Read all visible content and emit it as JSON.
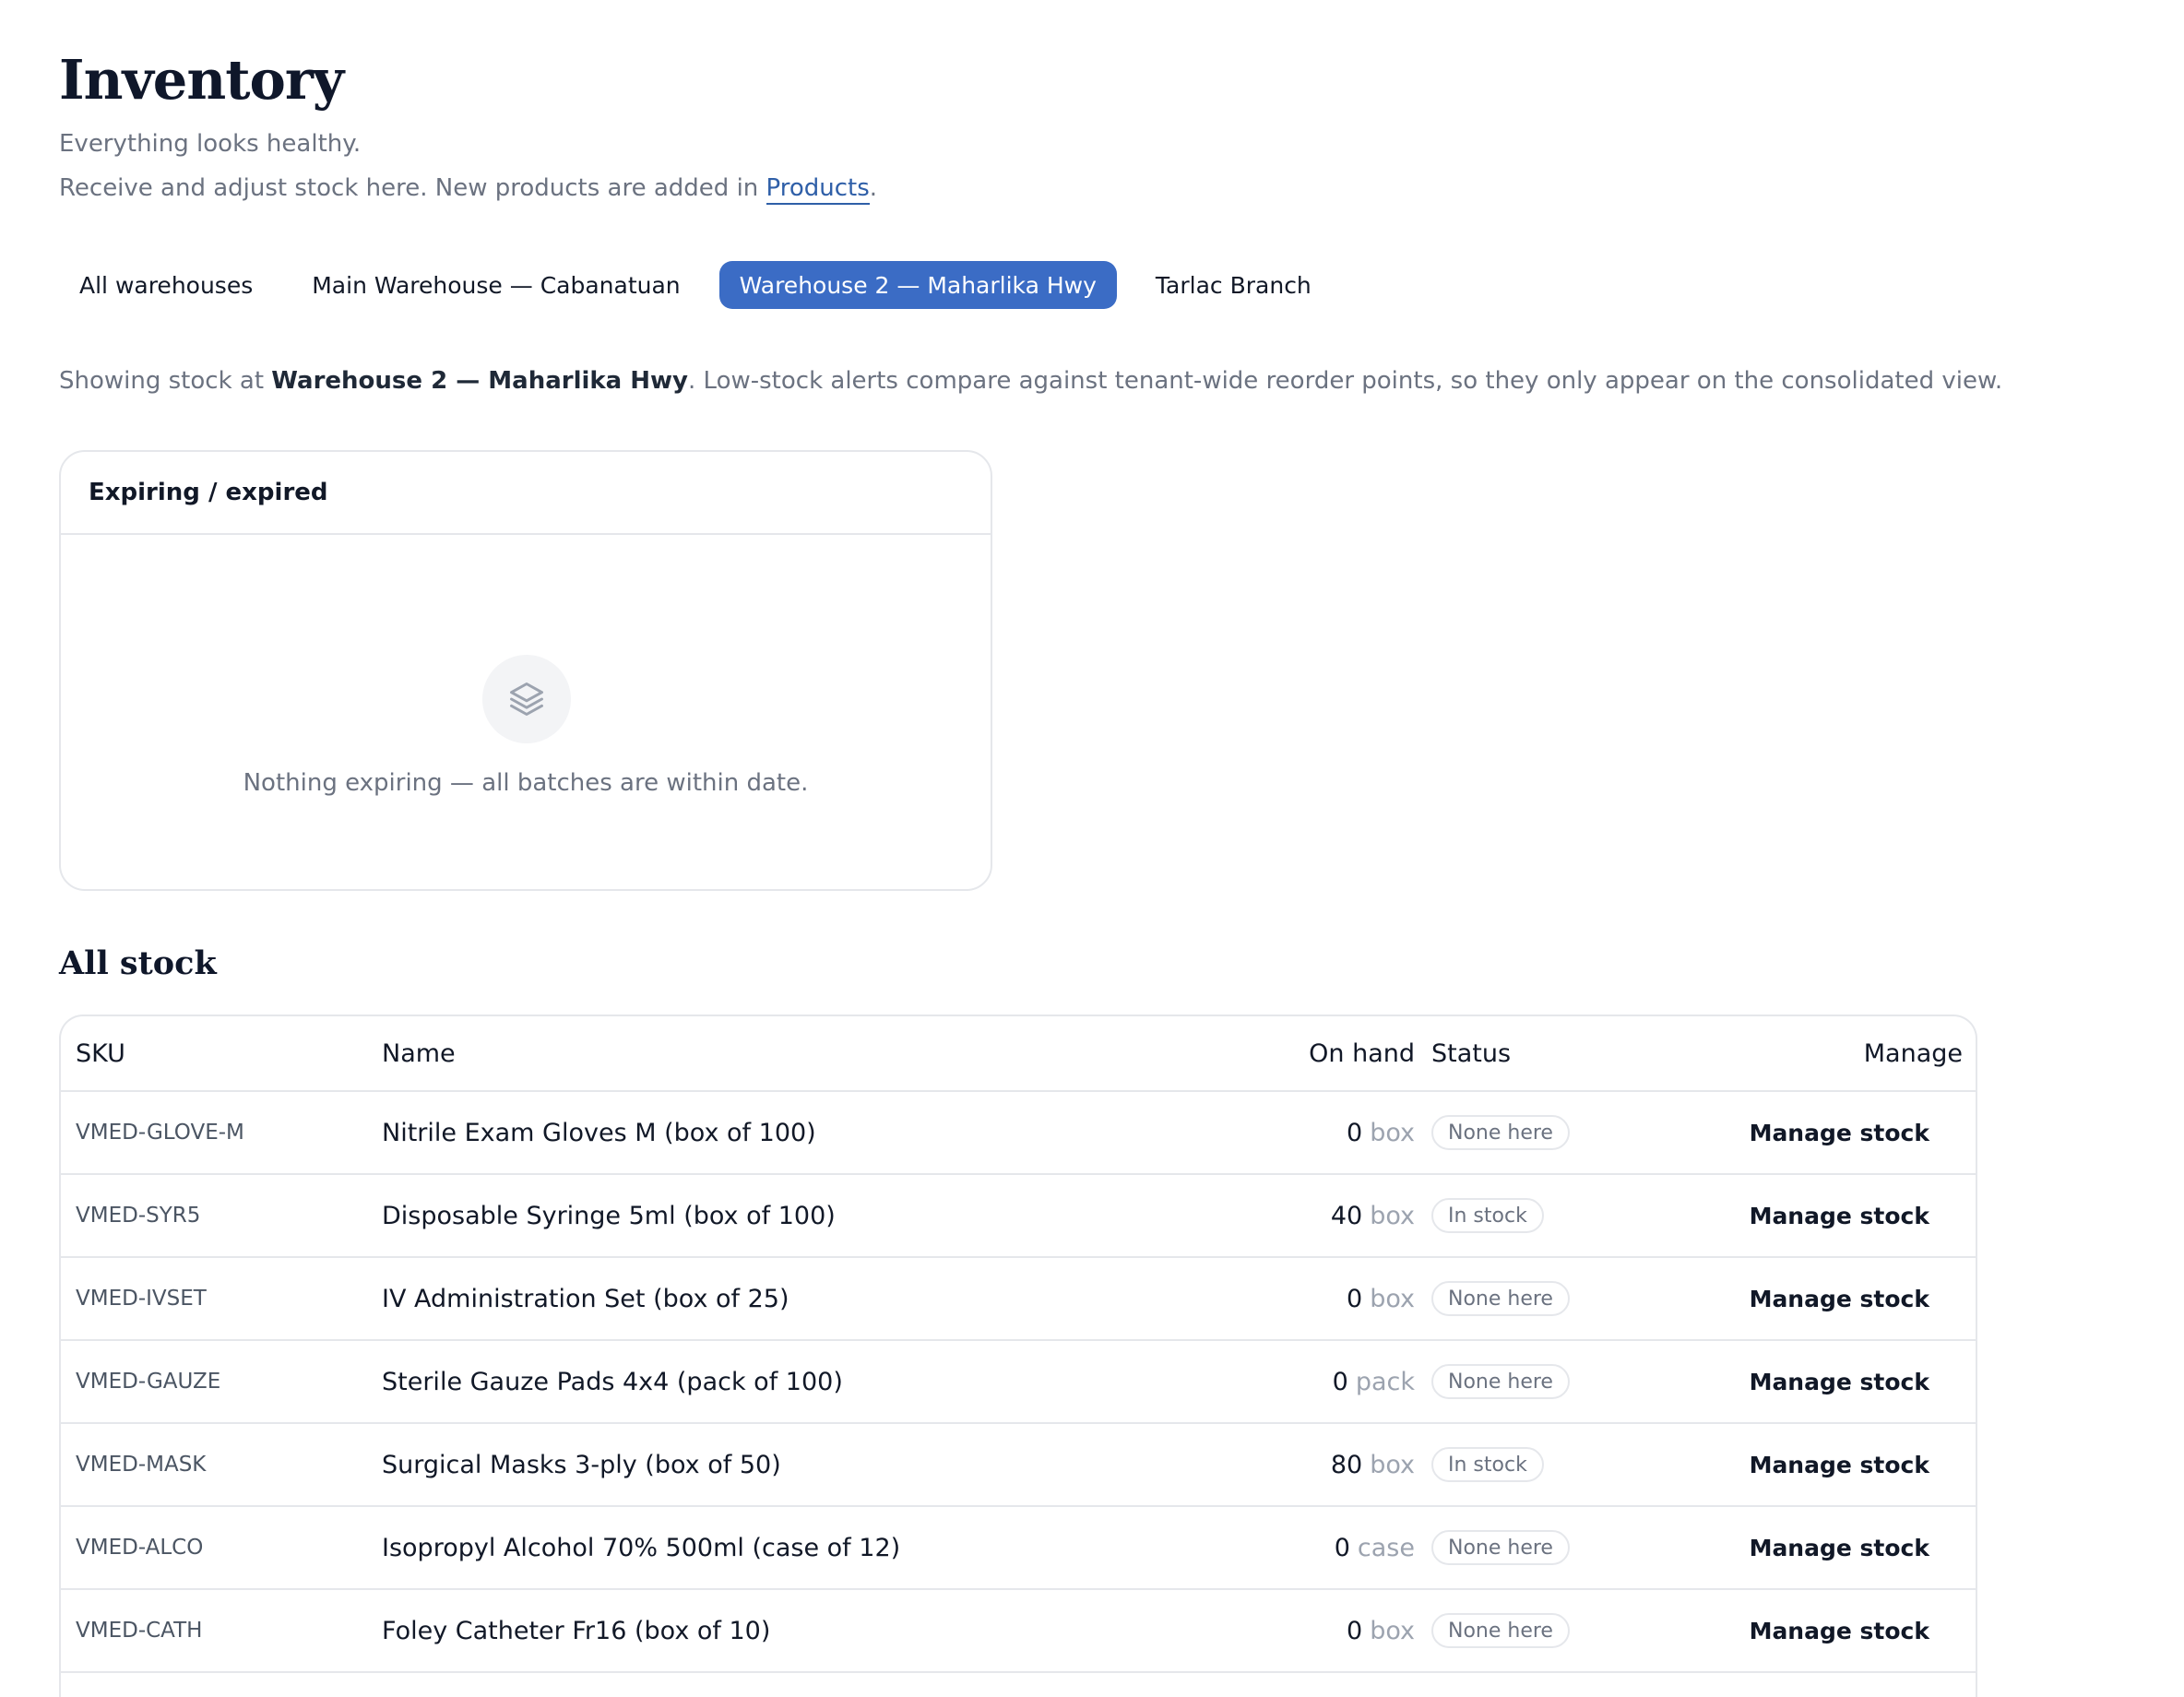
{
  "page": {
    "title": "Inventory",
    "subtitle": "Everything looks healthy.",
    "hint_prefix": "Receive and adjust stock here. New products are added in ",
    "hint_link": "Products",
    "hint_suffix": "."
  },
  "tabs": [
    {
      "label": "All warehouses",
      "active": false
    },
    {
      "label": "Main Warehouse — Cabanatuan",
      "active": false
    },
    {
      "label": "Warehouse 2 — Maharlika Hwy",
      "active": true
    },
    {
      "label": "Tarlac Branch",
      "active": false
    }
  ],
  "context": {
    "prefix": "Showing stock at ",
    "warehouse": "Warehouse 2 — Maharlika Hwy",
    "suffix": ". Low-stock alerts compare against tenant-wide reorder points, so they only appear on the consolidated view."
  },
  "expiring": {
    "title": "Expiring / expired",
    "empty_icon": "layers-icon",
    "empty_text": "Nothing expiring — all batches are within date."
  },
  "stock": {
    "title": "All stock",
    "columns": {
      "sku": "SKU",
      "name": "Name",
      "on_hand": "On hand",
      "status": "Status",
      "manage": "Manage"
    },
    "manage_label": "Manage stock",
    "rows": [
      {
        "sku": "VMED-GLOVE-M",
        "name": "Nitrile Exam Gloves M (box of 100)",
        "qty": "0",
        "unit": "box",
        "status": "None here"
      },
      {
        "sku": "VMED-SYR5",
        "name": "Disposable Syringe 5ml (box of 100)",
        "qty": "40",
        "unit": "box",
        "status": "In stock"
      },
      {
        "sku": "VMED-IVSET",
        "name": "IV Administration Set (box of 25)",
        "qty": "0",
        "unit": "box",
        "status": "None here"
      },
      {
        "sku": "VMED-GAUZE",
        "name": "Sterile Gauze Pads 4x4 (pack of 100)",
        "qty": "0",
        "unit": "pack",
        "status": "None here"
      },
      {
        "sku": "VMED-MASK",
        "name": "Surgical Masks 3-ply (box of 50)",
        "qty": "80",
        "unit": "box",
        "status": "In stock"
      },
      {
        "sku": "VMED-ALCO",
        "name": "Isopropyl Alcohol 70% 500ml (case of 12)",
        "qty": "0",
        "unit": "case",
        "status": "None here"
      },
      {
        "sku": "VMED-CATH",
        "name": "Foley Catheter Fr16 (box of 10)",
        "qty": "0",
        "unit": "box",
        "status": "None here"
      }
    ]
  },
  "colors": {
    "accent": "#3b6cc5",
    "link": "#2f5fa8",
    "border": "#e5e7eb",
    "muted": "#6b7280"
  }
}
